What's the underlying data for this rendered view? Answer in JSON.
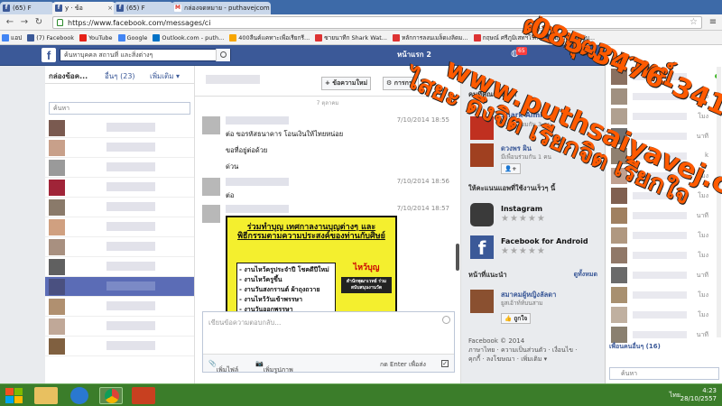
{
  "browser": {
    "tabs": [
      {
        "label": "(65) F",
        "icon": "facebook-icon"
      },
      {
        "label": "y · ข้อ",
        "icon": "facebook-icon"
      },
      {
        "label": "(65) F",
        "icon": "facebook-icon"
      },
      {
        "label": "กล่องจดหมาย - puthavejcom",
        "icon": "gmail-icon"
      }
    ],
    "url": "https://www.facebook.com/messages/ci",
    "bookmarks": [
      {
        "label": "แอป",
        "color": "#4285f4"
      },
      {
        "label": "(7) Facebook",
        "color": "#3b5998"
      },
      {
        "label": "YouTube",
        "color": "#e62117"
      },
      {
        "label": "Google",
        "color": "#4285f4"
      },
      {
        "label": "Outlook.com - puth...",
        "color": "#0072c6"
      },
      {
        "label": "400ลีนค์เเคทาะเพื่อเรียกรี...",
        "color": "#f7a600"
      },
      {
        "label": "ซายนาทีก Shark Wat...",
        "color": "#d33"
      },
      {
        "label": "หลักการลงนเมล็ดเงลิดม...",
        "color": "#d33"
      },
      {
        "label": "กฤษณ์ ศรีภูมิเสทฯโร...",
        "color": "#d33"
      },
      {
        "label": "มีรุ้ปเกิดกิจพับ...",
        "color": "#3b5998"
      }
    ]
  },
  "fb": {
    "search_placeholder": "ค้นหาบุคคล สถานที่ และสิ่งต่างๆ",
    "home": "หน้าแรก",
    "home_count": "2",
    "notif_count": "65"
  },
  "left": {
    "inbox": "กล่องข้อค...",
    "other": "อื่นๆ (23)",
    "more": "เพิ่มเติม ▾",
    "search_placeholder": "ค้นหา",
    "convos": [
      {
        "color": "#7a5a50",
        "selected": false
      },
      {
        "color": "#c8a08a",
        "selected": false
      },
      {
        "color": "#9a9a9a",
        "selected": false
      },
      {
        "color": "#a02438",
        "selected": false
      },
      {
        "color": "#8a7a6a",
        "selected": false
      },
      {
        "color": "#d0a080",
        "selected": false
      },
      {
        "color": "#a89080",
        "selected": false
      },
      {
        "color": "#606060",
        "selected": false
      },
      {
        "color": "#4a5080",
        "selected": true
      },
      {
        "color": "#b09070",
        "selected": false
      },
      {
        "color": "#c0a898",
        "selected": false
      },
      {
        "color": "#806040",
        "selected": false
      }
    ]
  },
  "thread": {
    "new_message": "+ ข้อความใหม่",
    "actions": "⚙ การกระ",
    "date_sep": "7 ตุลาคม",
    "messages": [
      {
        "time": "7/10/2014 18:55",
        "lines": [
          "ต่อ ขอรหัสธนาคาร โอนเงินให้ไทยหน่อย",
          "ขอที่อยู่ต่อด้วย",
          "ด่วน"
        ]
      },
      {
        "time": "7/10/2014 18:56",
        "lines": [
          "ต่อ"
        ]
      },
      {
        "time": "7/10/2014 18:57",
        "lines": []
      }
    ],
    "poster": {
      "title": "ร่วมทำบุญ เทศกาลงานบุญต่างๆ และพิธีกรรมตามความประสงค์ของท่านกับศิษย์",
      "items": [
        "- งานไหว้ครูประจำปี โชคดีปีใหม่",
        "- งานไหว้ครูขึ้น",
        "- งานวันสงกรานต์ ผ้าถุงถวาย",
        "- งานไหว้วันเข้าพรรษา",
        "- งานวันออกพรรษา"
      ],
      "side": "ไหว้บุญ",
      "side2": "สำนักพุฒาเวทย์ ร่วมสนับสนุนงานวัด"
    },
    "reply_placeholder": "เขียนข้อความตอบกลับ...",
    "add_file": "เพิ่มไฟล์",
    "add_photo": "เพิ่มรูปภาพ",
    "enter_to_send": "กด Enter เพื่อส่ง"
  },
  "right": {
    "people_head": "คนที่คุณอาจรู้จัก",
    "people": [
      {
        "name": "Shark Aimi",
        "meta": "มีเพื่อนร่วมกัน 3 คน",
        "color": "#c03020"
      },
      {
        "name": "ดวงพร ผิน",
        "meta": "มีเพื่อนร่วมกัน 1 คน",
        "color": "#a04020"
      }
    ],
    "apps_head": "ให้คะแนนแอพที่ใช้งานเร็วๆ นี้",
    "apps": [
      {
        "name": "Instagram",
        "stars": "★★★★★"
      },
      {
        "name": "Facebook for Android",
        "stars": "★★★★★"
      }
    ],
    "pages_head": "หน้าที่แนะนำ",
    "pages_link": "ดูทั้งหมด",
    "page": {
      "name": "สมาคมผู้หญิงลัลดา",
      "meta": "ยูสเอ้าท์ท์บนสาม",
      "like": "👍 ถูกใจ"
    },
    "footer_lines": [
      "Facebook © 2014",
      "ภาษาไทย · ความเป็นส่วนตัว · เงื่อนไข ·",
      "คุกกี้ · ลงโฆษณา · เพิ่มเติม ▾"
    ]
  },
  "chat": {
    "rows": [
      {
        "status": "",
        "color": "#8a7060"
      },
      {
        "status": "โมง",
        "color": "#a09080"
      },
      {
        "status": "โมง",
        "color": "#b0a090"
      },
      {
        "status": "นาที",
        "color": "#707070"
      },
      {
        "status": "k",
        "color": "#908070"
      },
      {
        "status": "โมง",
        "color": "#c0a090"
      },
      {
        "status": "โมง",
        "color": "#806050"
      },
      {
        "status": "นาที",
        "color": "#a08060"
      },
      {
        "status": "โมง",
        "color": "#b09880"
      },
      {
        "status": "โมง",
        "color": "#907868"
      },
      {
        "status": "นาที",
        "color": "#6a6a6a"
      },
      {
        "status": "โมง",
        "color": "#a89070"
      },
      {
        "status": "โมง",
        "color": "#c0b0a0"
      },
      {
        "status": "นาที",
        "color": "#8a8070"
      }
    ],
    "more_friends": "เพื่อนคนอื่นๆ (16)",
    "search_placeholder": "ค้นหา"
  },
  "overlay": {
    "line1": "ต่อ พุฒาเวทย์",
    "line2": "085-3476-341",
    "line3": "www.puthsaiyavej.com",
    "line4": "ไสยะ ดึงจิต เรียกจิต เรียกใจ"
  },
  "taskbar": {
    "time": "4:23",
    "date": "28/10/2557",
    "lang": "ไทย"
  }
}
